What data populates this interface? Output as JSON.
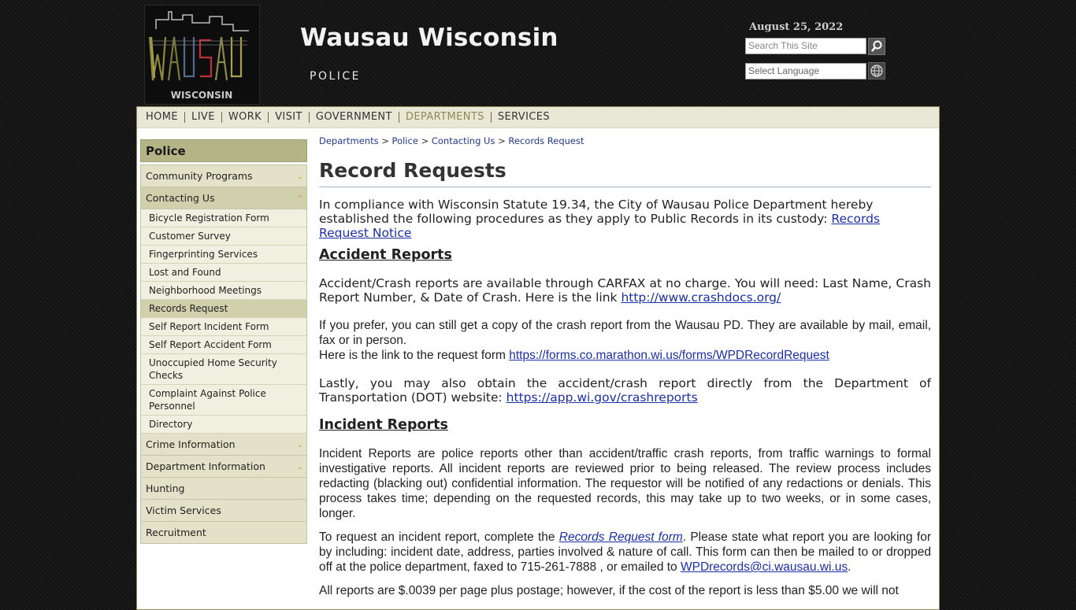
{
  "header": {
    "site_title": "Wausau Wisconsin",
    "site_subtitle": "POLICE",
    "date": "August 25, 2022",
    "logo_text": "WAUSAU",
    "logo_subtext": "WISCONSIN",
    "search_placeholder": "Search This Site",
    "language_label": "Select Language",
    "search_icon": "search-icon",
    "globe_icon": "globe-icon"
  },
  "topnav": {
    "items": [
      "HOME",
      "LIVE",
      "WORK",
      "VISIT",
      "GOVERNMENT",
      "DEPARTMENTS",
      "SERVICES"
    ],
    "active": "DEPARTMENTS"
  },
  "sidebar": {
    "heading": "Police",
    "items": [
      {
        "label": "Community Programs"
      },
      {
        "label": "Contacting Us"
      },
      {
        "label": "Crime Information"
      },
      {
        "label": "Department Information"
      },
      {
        "label": "Hunting"
      },
      {
        "label": "Victim Services"
      },
      {
        "label": "Recruitment"
      }
    ],
    "subitems": [
      "Bicycle Registration Form",
      "Customer Survey",
      "Fingerprinting Services",
      "Lost and Found",
      "Neighborhood Meetings",
      "Records Request",
      "Self Report Incident Form",
      "Self Report Accident Form",
      "Unoccupied Home Security Checks",
      "Complaint Against Police Personnel",
      "Directory"
    ]
  },
  "breadcrumb": {
    "items": [
      "Departments",
      "Police",
      "Contacting Us",
      "Records Request"
    ],
    "separator": ">"
  },
  "content": {
    "title": "Record Requests",
    "intro_text": "In compliance with Wisconsin Statute 19.34, the City of Wausau Police Department hereby established the following procedures as they apply to Public Records in its custody: ",
    "intro_link": "Records Request Notice",
    "accident_heading": "Accident Reports",
    "accident_p1_text": "Accident/Crash reports are available through CARFAX at no charge.  You will need:  Last Name, Crash Report Number, & Date of Crash.   Here is the link  ",
    "accident_p1_link": "http://www.crashdocs.org/",
    "accident_p2_text": "If you prefer, you can still get a copy of the crash report from the Wausau PD.  They are available by mail, email, fax or in person.",
    "accident_p2b_text": "Here is the link to the request form ",
    "accident_p2_link": "https://forms.co.marathon.wi.us/forms/WPDRecordRequest",
    "accident_p3_text": "Lastly, you may also obtain the accident/crash report directly from the Department of Transportation (DOT) website: ",
    "accident_p3_link": "https://app.wi.gov/crashreports",
    "incident_heading": "Incident Reports",
    "incident_p1": "Incident Reports are police reports other than accident/traffic crash reports, from traffic warnings to formal investigative reports.  All incident reports are reviewed prior to being released.  The review process includes redacting (blacking out) confidential information.  The requestor will be notified of any redactions or denials.  This process takes time; depending on the requested records, this may take up to two weeks, or in some cases, longer.",
    "incident_p2_a": "To request an incident report, complete the ",
    "incident_p2_link": "Records Request form",
    "incident_p2_b": ". Please state what report you are looking for by including: incident date, address, parties involved & nature of call.  This form can then be mailed to or dropped off at the police department, faxed to 715-261-7888 , or emailed to ",
    "incident_p2_email": "WPDrecords@ci.wausau.wi.us",
    "incident_p2_end": ".",
    "incident_p3": "All reports are $.0039 per page plus postage; however, if the cost of the report is less than $5.00 we will not"
  },
  "colors": {
    "nav_bg": "#e9e7d6",
    "sidebar_head": "#b4b487",
    "link": "#1b2fa8",
    "active_nav": "#8a8b55"
  }
}
